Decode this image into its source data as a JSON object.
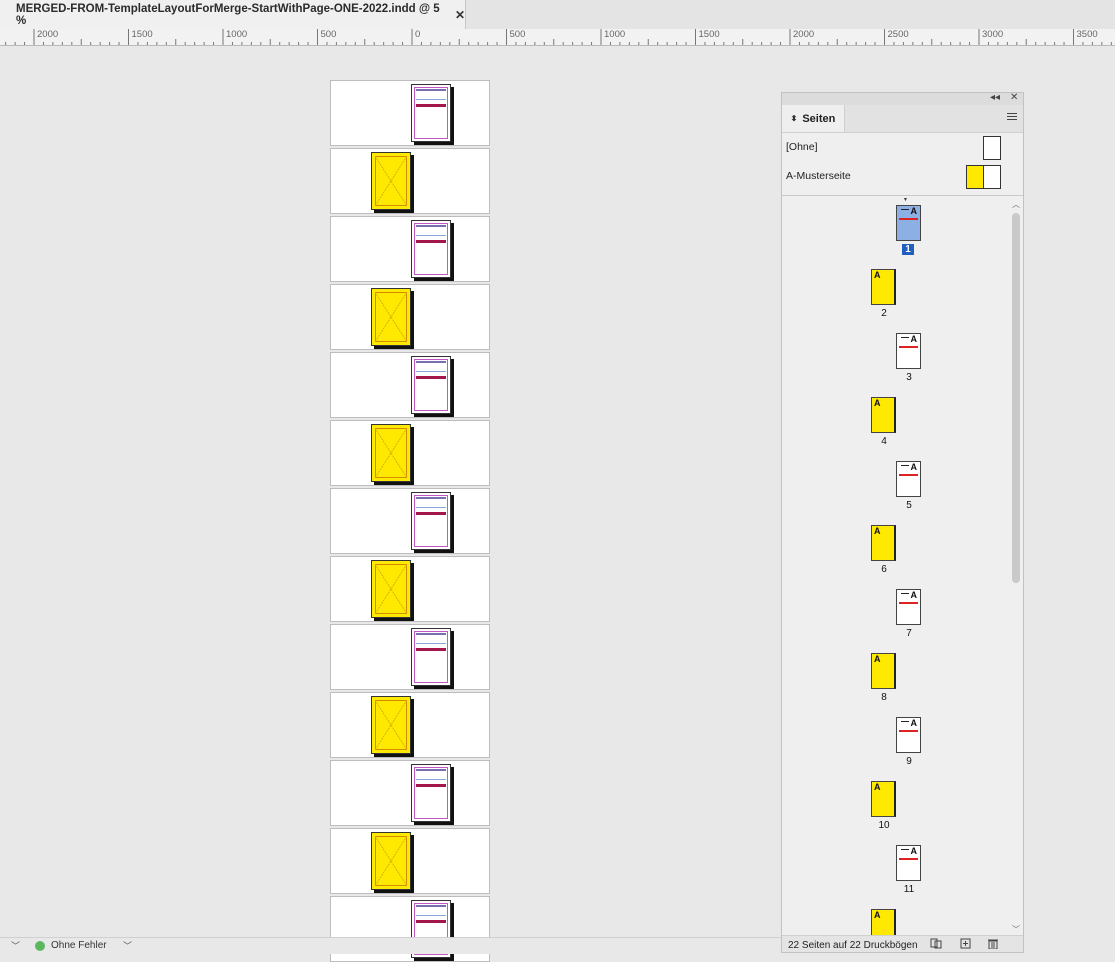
{
  "document_tab": {
    "title": "MERGED-FROM-TemplateLayoutForMerge-StartWithPage-ONE-2022.indd @ 5 %",
    "close_glyph": "✕"
  },
  "ruler": {
    "labels": [
      "2000",
      "1500",
      "1000",
      "500",
      "0",
      "500",
      "1000",
      "1500",
      "2000",
      "2500",
      "3000",
      "3500"
    ]
  },
  "spreads": [
    {
      "kind": "right"
    },
    {
      "kind": "left"
    },
    {
      "kind": "right"
    },
    {
      "kind": "left"
    },
    {
      "kind": "right"
    },
    {
      "kind": "left"
    },
    {
      "kind": "right"
    },
    {
      "kind": "left"
    },
    {
      "kind": "right"
    },
    {
      "kind": "left"
    },
    {
      "kind": "right"
    },
    {
      "kind": "left"
    },
    {
      "kind": "right"
    }
  ],
  "pages_panel": {
    "tab_label": "Seiten",
    "collapse_glyph": "◂◂",
    "close_glyph": "✕",
    "masters": [
      {
        "name": "[Ohne]"
      },
      {
        "name": "A-Musterseite"
      }
    ],
    "pages": [
      {
        "number": "1",
        "side": "right",
        "selected": true,
        "master": "A"
      },
      {
        "number": "2",
        "side": "left",
        "master": "A"
      },
      {
        "number": "3",
        "side": "right",
        "master": "A"
      },
      {
        "number": "4",
        "side": "left",
        "master": "A"
      },
      {
        "number": "5",
        "side": "right",
        "master": "A"
      },
      {
        "number": "6",
        "side": "left",
        "master": "A"
      },
      {
        "number": "7",
        "side": "right",
        "master": "A"
      },
      {
        "number": "8",
        "side": "left",
        "master": "A"
      },
      {
        "number": "9",
        "side": "right",
        "master": "A"
      },
      {
        "number": "10",
        "side": "left",
        "master": "A"
      },
      {
        "number": "11",
        "side": "right",
        "master": "A"
      },
      {
        "number": "",
        "side": "left",
        "master": "A"
      }
    ],
    "footer_text": "22 Seiten auf 22 Druckbögen"
  },
  "status": {
    "message": "Ohne Fehler",
    "color": "#5cb85c"
  },
  "colors": {
    "page_yellow": "#ffe900",
    "selection_blue": "#1f5fbf",
    "spread_magenta": "#c159c1",
    "header_red": "#a3174d"
  }
}
